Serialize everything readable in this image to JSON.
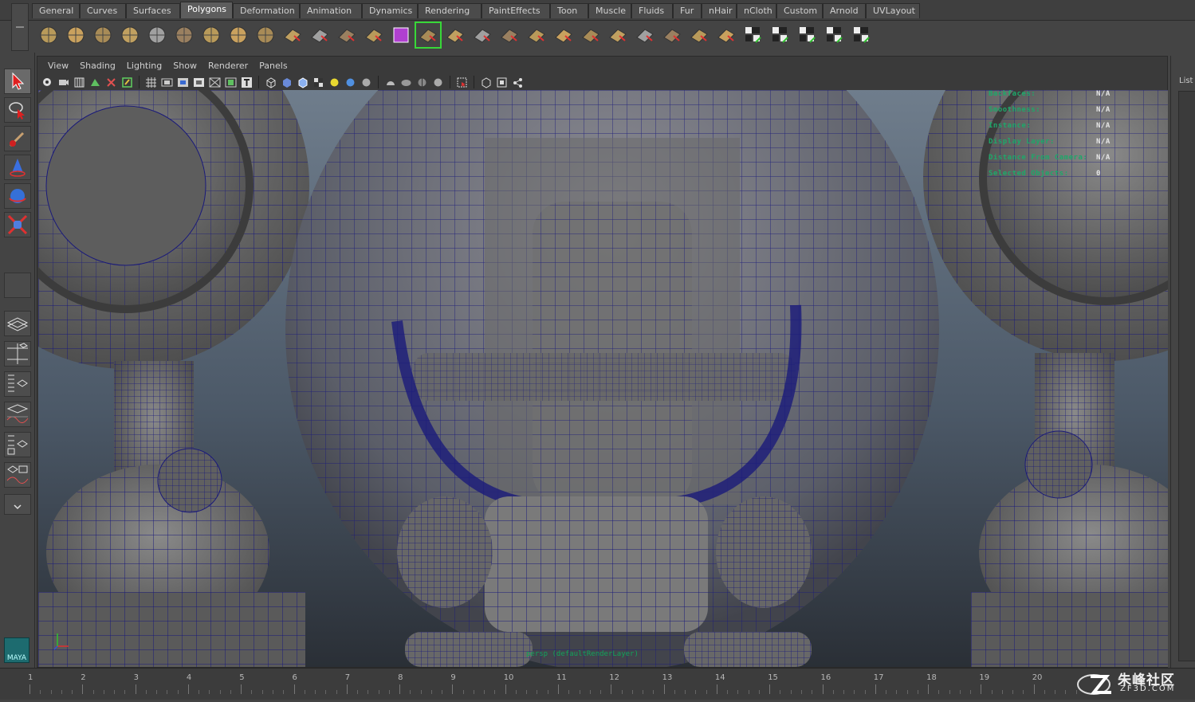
{
  "shelf": {
    "tabs": [
      {
        "label": "General",
        "w": 60
      },
      {
        "label": "Curves",
        "w": 58
      },
      {
        "label": "Surfaces",
        "w": 68
      },
      {
        "label": "Polygons",
        "w": 66,
        "active": true
      },
      {
        "label": "Deformation",
        "w": 84
      },
      {
        "label": "Animation",
        "w": 78
      },
      {
        "label": "Dynamics",
        "w": 70
      },
      {
        "label": "Rendering",
        "w": 80
      },
      {
        "label": "PaintEffects",
        "w": 86
      },
      {
        "label": "Toon",
        "w": 48
      },
      {
        "label": "Muscle",
        "w": 54
      },
      {
        "label": "Fluids",
        "w": 52
      },
      {
        "label": "Fur",
        "w": 36
      },
      {
        "label": "nHair",
        "w": 44
      },
      {
        "label": "nCloth",
        "w": 50
      },
      {
        "label": "Custom",
        "w": 58
      },
      {
        "label": "Arnold",
        "w": 54
      },
      {
        "label": "UVLayout",
        "w": 68
      }
    ],
    "icons": [
      "poly-sphere-icon",
      "poly-cube-icon",
      "poly-cylinder-icon",
      "poly-cone-icon",
      "poly-plane-icon",
      "poly-torus-icon",
      "poly-pyramid-icon",
      "poly-pipe-icon",
      "poly-helix-icon",
      "combine-icon",
      "separate-icon",
      "smooth-icon",
      "boolean-icon",
      "polygon-cube-icon",
      "uv-icon",
      "extrude-icon",
      "bridge-icon",
      "append-icon",
      "split-icon",
      "bevel-icon",
      "merge-icon",
      "insert-edge-loop-icon",
      "wedge-icon",
      "slide-edge-icon",
      "cut-faces-icon",
      "soft-mod-icon",
      "texture-checker-icon",
      "uv-snapshot-icon",
      "uv-checker-icon",
      "uv-unfold-icon",
      "uv-layout-icon"
    ]
  },
  "panel": {
    "menu": [
      "View",
      "Shading",
      "Lighting",
      "Show",
      "Renderer",
      "Panels"
    ]
  },
  "hud": {
    "rows": [
      {
        "key": "Backfaces:",
        "value": "N/A"
      },
      {
        "key": "Smoothness:",
        "value": "N/A"
      },
      {
        "key": "Instance:",
        "value": "N/A"
      },
      {
        "key": "Display Layer:",
        "value": "N/A"
      },
      {
        "key": "Distance From Camera:",
        "value": "N/A"
      },
      {
        "key": "Selected Objects:",
        "value": "0"
      }
    ],
    "camera_label": "persp (defaultRenderLayer)"
  },
  "right_panel": {
    "label": "List"
  },
  "timeline": {
    "frames": [
      "1",
      "2",
      "3",
      "4",
      "5",
      "6",
      "7",
      "8",
      "9",
      "10",
      "11",
      "12",
      "13",
      "14",
      "15",
      "16",
      "17",
      "18",
      "19",
      "20"
    ]
  },
  "watermark": {
    "title": "朱峰社区",
    "subtitle": "ZF3D.COM"
  },
  "logo": {
    "text": "MAYA"
  },
  "colors": {
    "wire": "#1a1a7a",
    "hud": "#1ea86a",
    "select": "#38d838"
  }
}
